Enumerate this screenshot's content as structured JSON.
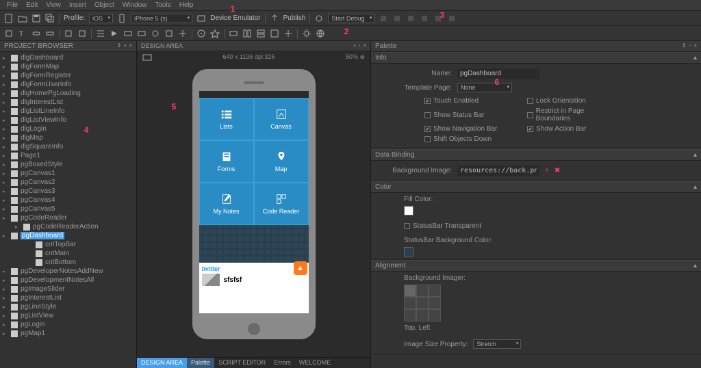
{
  "menu": {
    "file": "File",
    "edit": "Edit",
    "view": "View",
    "insert": "Insert",
    "object": "Object",
    "window": "Window",
    "tools": "Tools",
    "help": "Help"
  },
  "toolbar1": {
    "profile_label": "Profile:",
    "profile_value": "iOS",
    "device_value": "iPhone 5 (s)",
    "device_emulator": "Device Emulator",
    "publish": "Publish",
    "start_debug": "Start Debug"
  },
  "project_browser": {
    "title": "PROJECT BROWSER",
    "items": [
      {
        "l": "dlgDashboard",
        "lvl": 0
      },
      {
        "l": "dlgFormMap",
        "lvl": 0
      },
      {
        "l": "dlgFormRegister",
        "lvl": 0
      },
      {
        "l": "dlgFormUserInfo",
        "lvl": 0
      },
      {
        "l": "dlgHomePgLoading",
        "lvl": 0
      },
      {
        "l": "dlgInterestList",
        "lvl": 0
      },
      {
        "l": "dlgListLineInfo",
        "lvl": 0
      },
      {
        "l": "dlgListViewInfo",
        "lvl": 0
      },
      {
        "l": "dlgLogin",
        "lvl": 0
      },
      {
        "l": "dlgMap",
        "lvl": 0
      },
      {
        "l": "dlgSquareInfo",
        "lvl": 0
      },
      {
        "l": "Page1",
        "lvl": 0
      },
      {
        "l": "pgBoxedStyle",
        "lvl": 0
      },
      {
        "l": "pgCanvas1",
        "lvl": 0
      },
      {
        "l": "pgCanvas2",
        "lvl": 0
      },
      {
        "l": "pgCanvas3",
        "lvl": 0
      },
      {
        "l": "pgCanvas4",
        "lvl": 0
      },
      {
        "l": "pgCanvas5",
        "lvl": 0
      },
      {
        "l": "pgCodeReader",
        "lvl": 0
      },
      {
        "l": "pgCodeReaderAction",
        "lvl": 1
      },
      {
        "l": "pgDashboard",
        "lvl": 0,
        "sel": true
      },
      {
        "l": "cntTopBar",
        "lvl": 2
      },
      {
        "l": "cntMain",
        "lvl": 2
      },
      {
        "l": "cntBottom",
        "lvl": 2
      },
      {
        "l": "pgDeveloperNotesAddNew",
        "lvl": 0
      },
      {
        "l": "pgDevelopmentNotesAll",
        "lvl": 0
      },
      {
        "l": "pgImageSlider",
        "lvl": 0
      },
      {
        "l": "pgInterestList",
        "lvl": 0
      },
      {
        "l": "pgLineStyle",
        "lvl": 0
      },
      {
        "l": "pgListView",
        "lvl": 0
      },
      {
        "l": "pgLogin",
        "lvl": 0
      },
      {
        "l": "pgMap1",
        "lvl": 0
      }
    ]
  },
  "design": {
    "title": "DESIGN AREA",
    "dimensions": "640 x 1136 dpi:326",
    "zoom": "50%"
  },
  "tiles": {
    "lists": "Lists",
    "canvas": "Canvas",
    "forms": "Forms",
    "map": "Map",
    "notes": "My Notes",
    "code": "Code Reader"
  },
  "tweet": {
    "brand": "twitter",
    "text": "sfsfsf"
  },
  "palette": {
    "title": "Palette",
    "info": "Info",
    "name_label": "Name:",
    "name_value": "pgDashboard",
    "template_label": "Template Page:",
    "template_value": "None",
    "checks": {
      "touch": "Touch Enabled",
      "lock": "Lock Orientation",
      "status": "Show Status Bar",
      "restrict": "Restrict in Page Boundaries",
      "nav": "Show Navigation Bar",
      "action": "Show Action Bar",
      "shift": "Shift Objects Down"
    },
    "databinding": "Data Binding",
    "bg_image_label": "Background Image:",
    "bg_image_value": "resources://back.png",
    "color": "Color",
    "fill_color": "Fill Color:",
    "statusbar_transparent": "StatusBar Transparent",
    "statusbar_bg": "StatusBar Background Color:",
    "alignment": "Alignment",
    "bg_imager": "Background Imager:",
    "topleft": "Top, Left",
    "image_size_prop": "Image Size Property:",
    "stretch": "Stretch"
  },
  "footer": {
    "design_area": "DESIGN AREA",
    "palette": "Palette",
    "script": "SCRIPT EDITOR",
    "errors": "Errors",
    "welcome": "WELCOME"
  },
  "callouts": {
    "1": "1",
    "2": "2",
    "3": "3",
    "4": "4",
    "5": "5",
    "6": "6"
  }
}
